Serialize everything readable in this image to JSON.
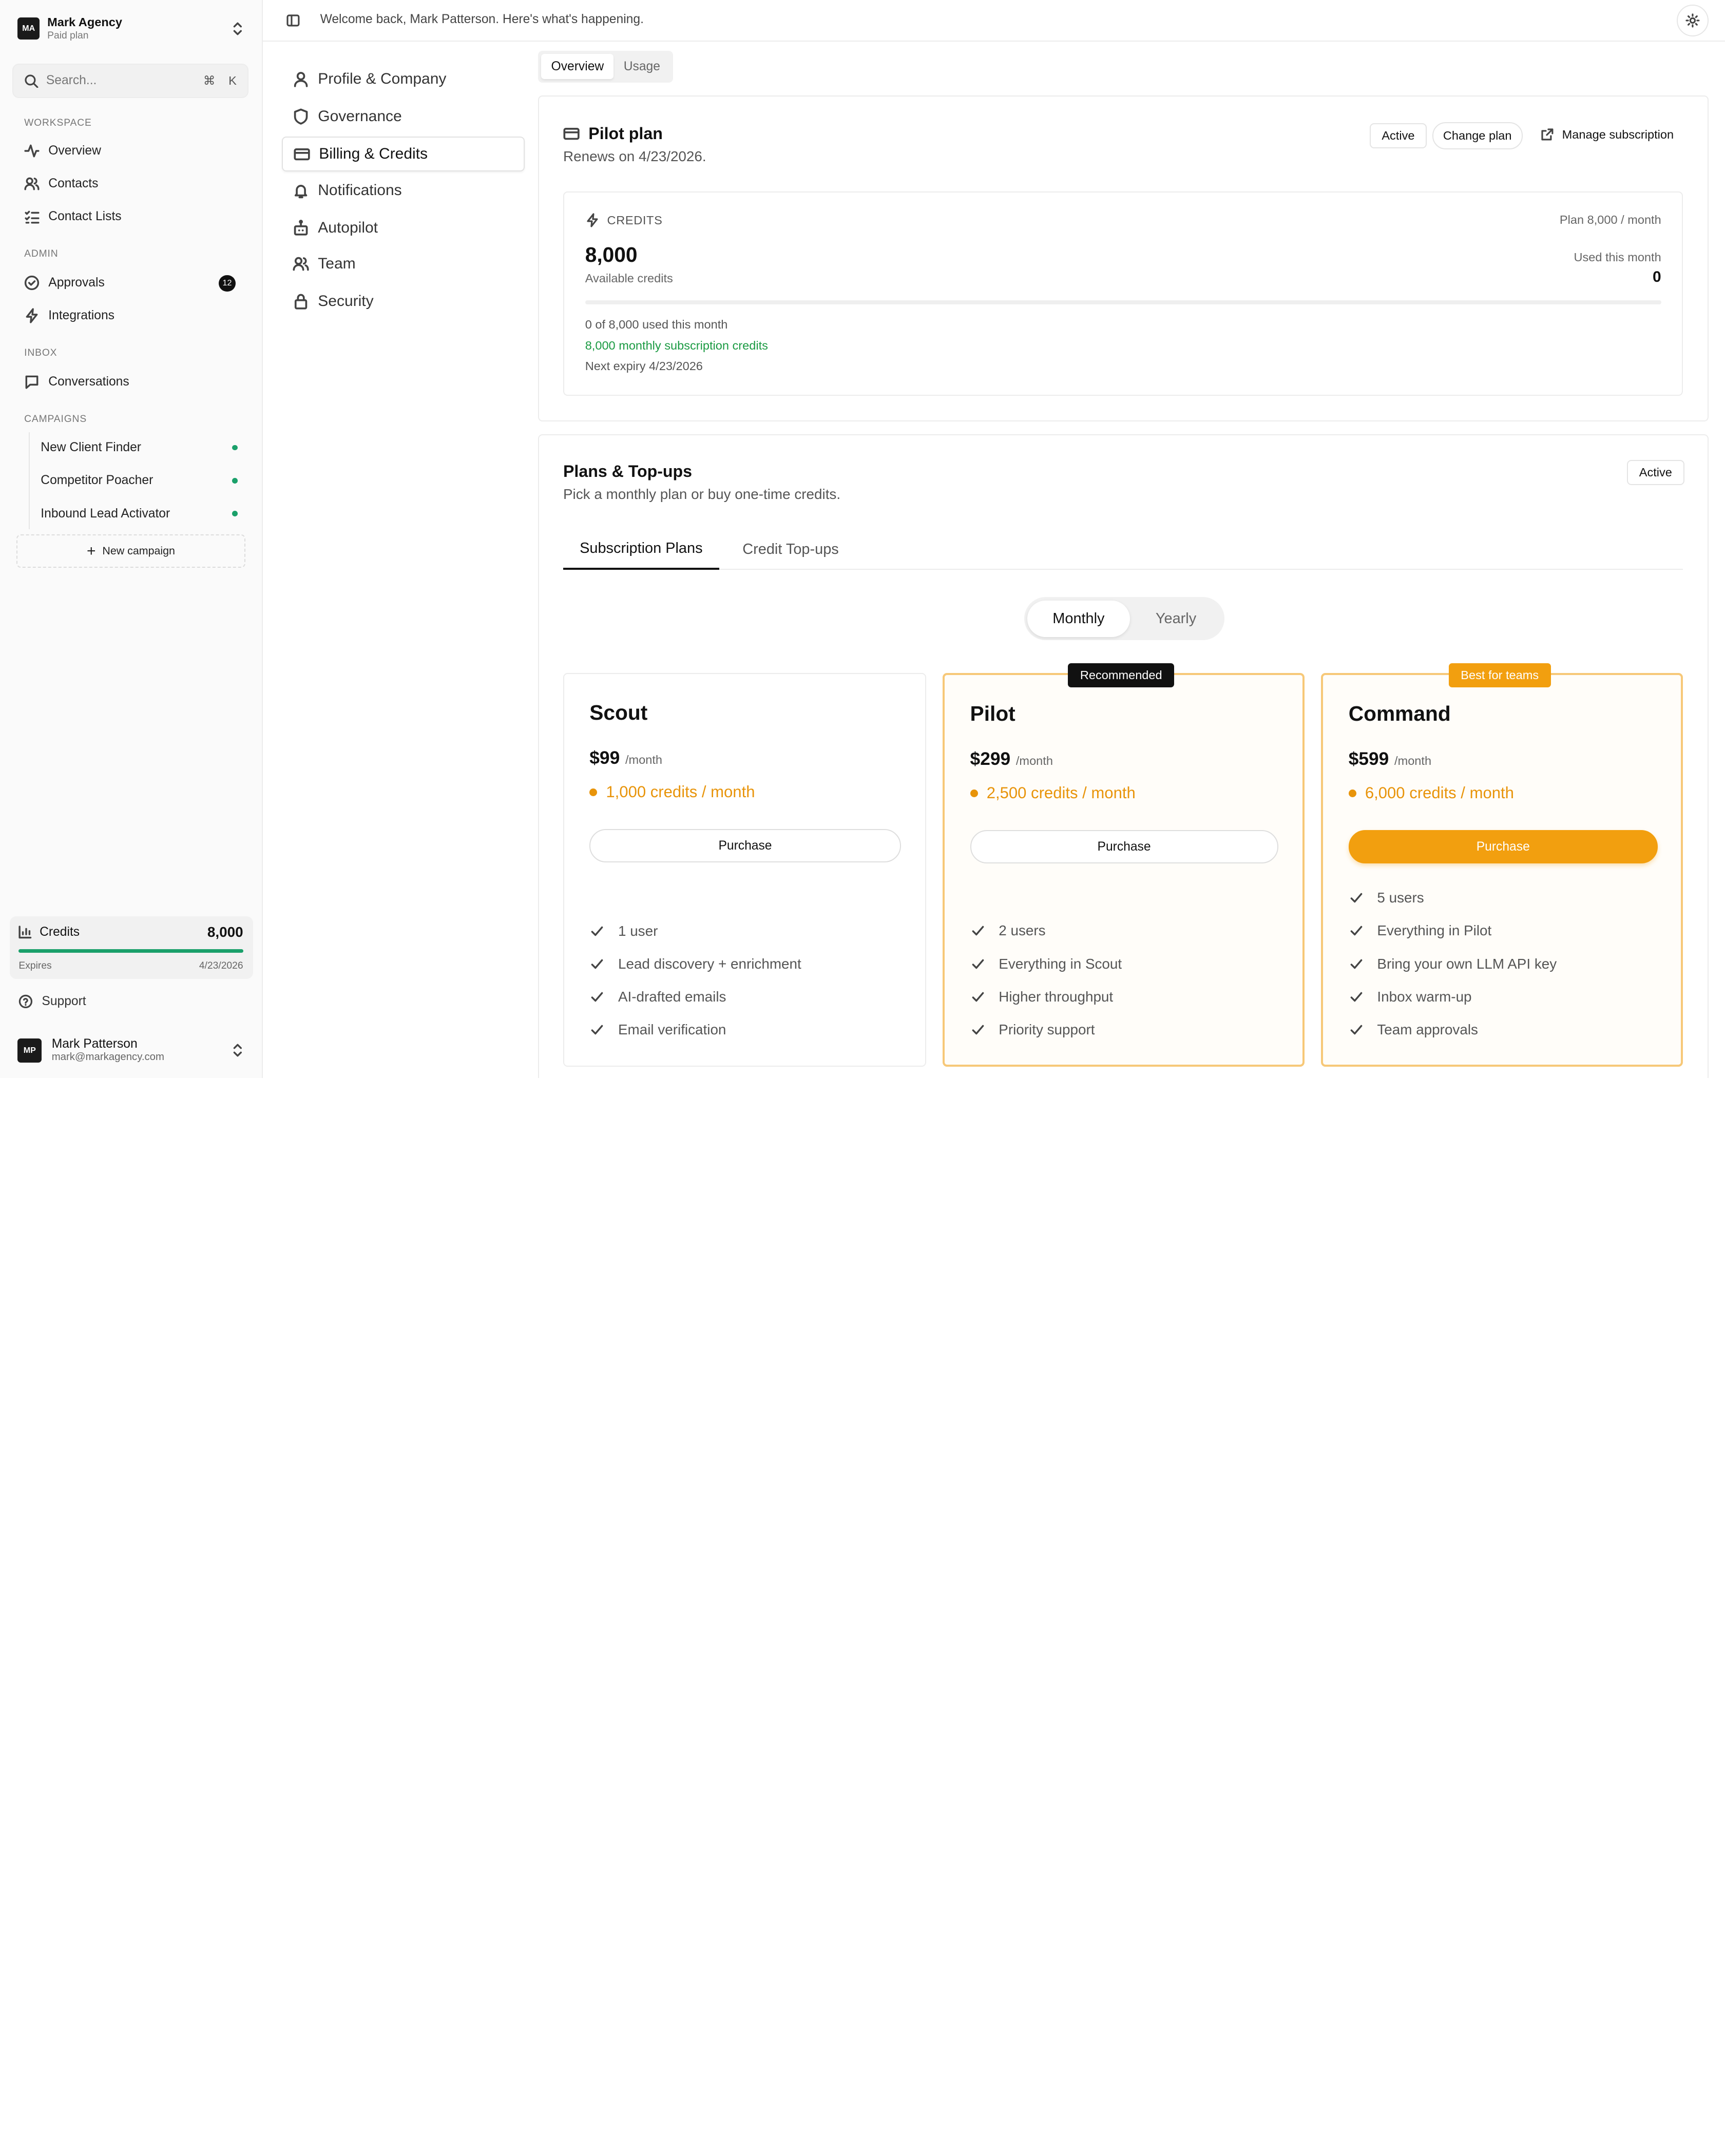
{
  "org": {
    "initials": "MA",
    "name": "Mark Agency",
    "plan": "Paid plan"
  },
  "search": {
    "placeholder": "Search...",
    "shortcut_cmd": "⌘",
    "shortcut_key": "K"
  },
  "sections": {
    "workspace": "WORKSPACE",
    "admin": "ADMIN",
    "inbox": "INBOX",
    "campaigns": "CAMPAIGNS"
  },
  "nav": {
    "overview": "Overview",
    "contacts": "Contacts",
    "contact_lists": "Contact Lists",
    "approvals": "Approvals",
    "approvals_badge": "12",
    "integrations": "Integrations",
    "conversations": "Conversations"
  },
  "campaigns": [
    {
      "name": "New Client Finder",
      "status_color": "#1aa06a"
    },
    {
      "name": "Competitor Poacher",
      "status_color": "#1aa06a"
    },
    {
      "name": "Inbound Lead Activator",
      "status_color": "#1aa06a"
    }
  ],
  "new_campaign": "New campaign",
  "sidebar_credits": {
    "label": "Credits",
    "value": "8,000",
    "expires_label": "Expires",
    "expires_date": "4/23/2026",
    "fill_fraction": 1.0
  },
  "support": "Support",
  "user": {
    "initials": "MP",
    "name": "Mark Patterson",
    "email": "mark@markagency.com"
  },
  "topbar": {
    "welcome": "Welcome back, Mark Patterson. Here's what's happening."
  },
  "settings_nav": [
    {
      "label": "Profile & Company",
      "icon": "user-icon"
    },
    {
      "label": "Governance",
      "icon": "shield-icon"
    },
    {
      "label": "Billing & Credits",
      "icon": "credit-card-icon",
      "active": true
    },
    {
      "label": "Notifications",
      "icon": "bell-icon"
    },
    {
      "label": "Autopilot",
      "icon": "robot-icon"
    },
    {
      "label": "Team",
      "icon": "users-icon"
    },
    {
      "label": "Security",
      "icon": "lock-icon"
    }
  ],
  "view_tabs": {
    "overview": "Overview",
    "usage": "Usage"
  },
  "current_plan": {
    "title": "Pilot plan",
    "renews": "Renews on 4/23/2026.",
    "status": "Active",
    "change": "Change plan",
    "manage": "Manage subscription"
  },
  "credits": {
    "label": "CREDITS",
    "available": "8,000",
    "available_label": "Available credits",
    "plan_line": "Plan 8,000 / month",
    "used_label": "Used this month",
    "used_value": "0",
    "used_fraction": 0,
    "line1": "0 of 8,000 used this month",
    "line2": "8,000 monthly subscription credits",
    "line3": "Next expiry 4/23/2026"
  },
  "plans_section": {
    "title": "Plans & Top-ups",
    "subtitle": "Pick a monthly plan or buy one-time credits.",
    "status": "Active",
    "tab_subscription": "Subscription Plans",
    "tab_topups": "Credit Top-ups",
    "monthly": "Monthly",
    "yearly": "Yearly"
  },
  "plans": [
    {
      "name": "Scout",
      "price": "$99",
      "per": "/month",
      "credits": "1,000 credits / month",
      "button": "Purchase",
      "features": [
        "1 user",
        "Lead discovery + enrichment",
        "AI-drafted emails",
        "Email verification"
      ]
    },
    {
      "name": "Pilot",
      "price": "$299",
      "per": "/month",
      "credits": "2,500 credits / month",
      "button": "Purchase",
      "tag": "Recommended",
      "features": [
        "2 users",
        "Everything in Scout",
        "Higher throughput",
        "Priority support"
      ]
    },
    {
      "name": "Command",
      "price": "$599",
      "per": "/month",
      "credits": "6,000 credits / month",
      "button": "Purchase",
      "tag": "Best for teams",
      "features": [
        "5 users",
        "Everything in Pilot",
        "Bring your own LLM API key",
        "Inbox warm-up",
        "Team approvals"
      ]
    }
  ],
  "colors": {
    "accent_orange": "#f29f0f",
    "credit_orange": "#e8940a",
    "success_green": "#1aa06a",
    "dark": "#111111"
  }
}
